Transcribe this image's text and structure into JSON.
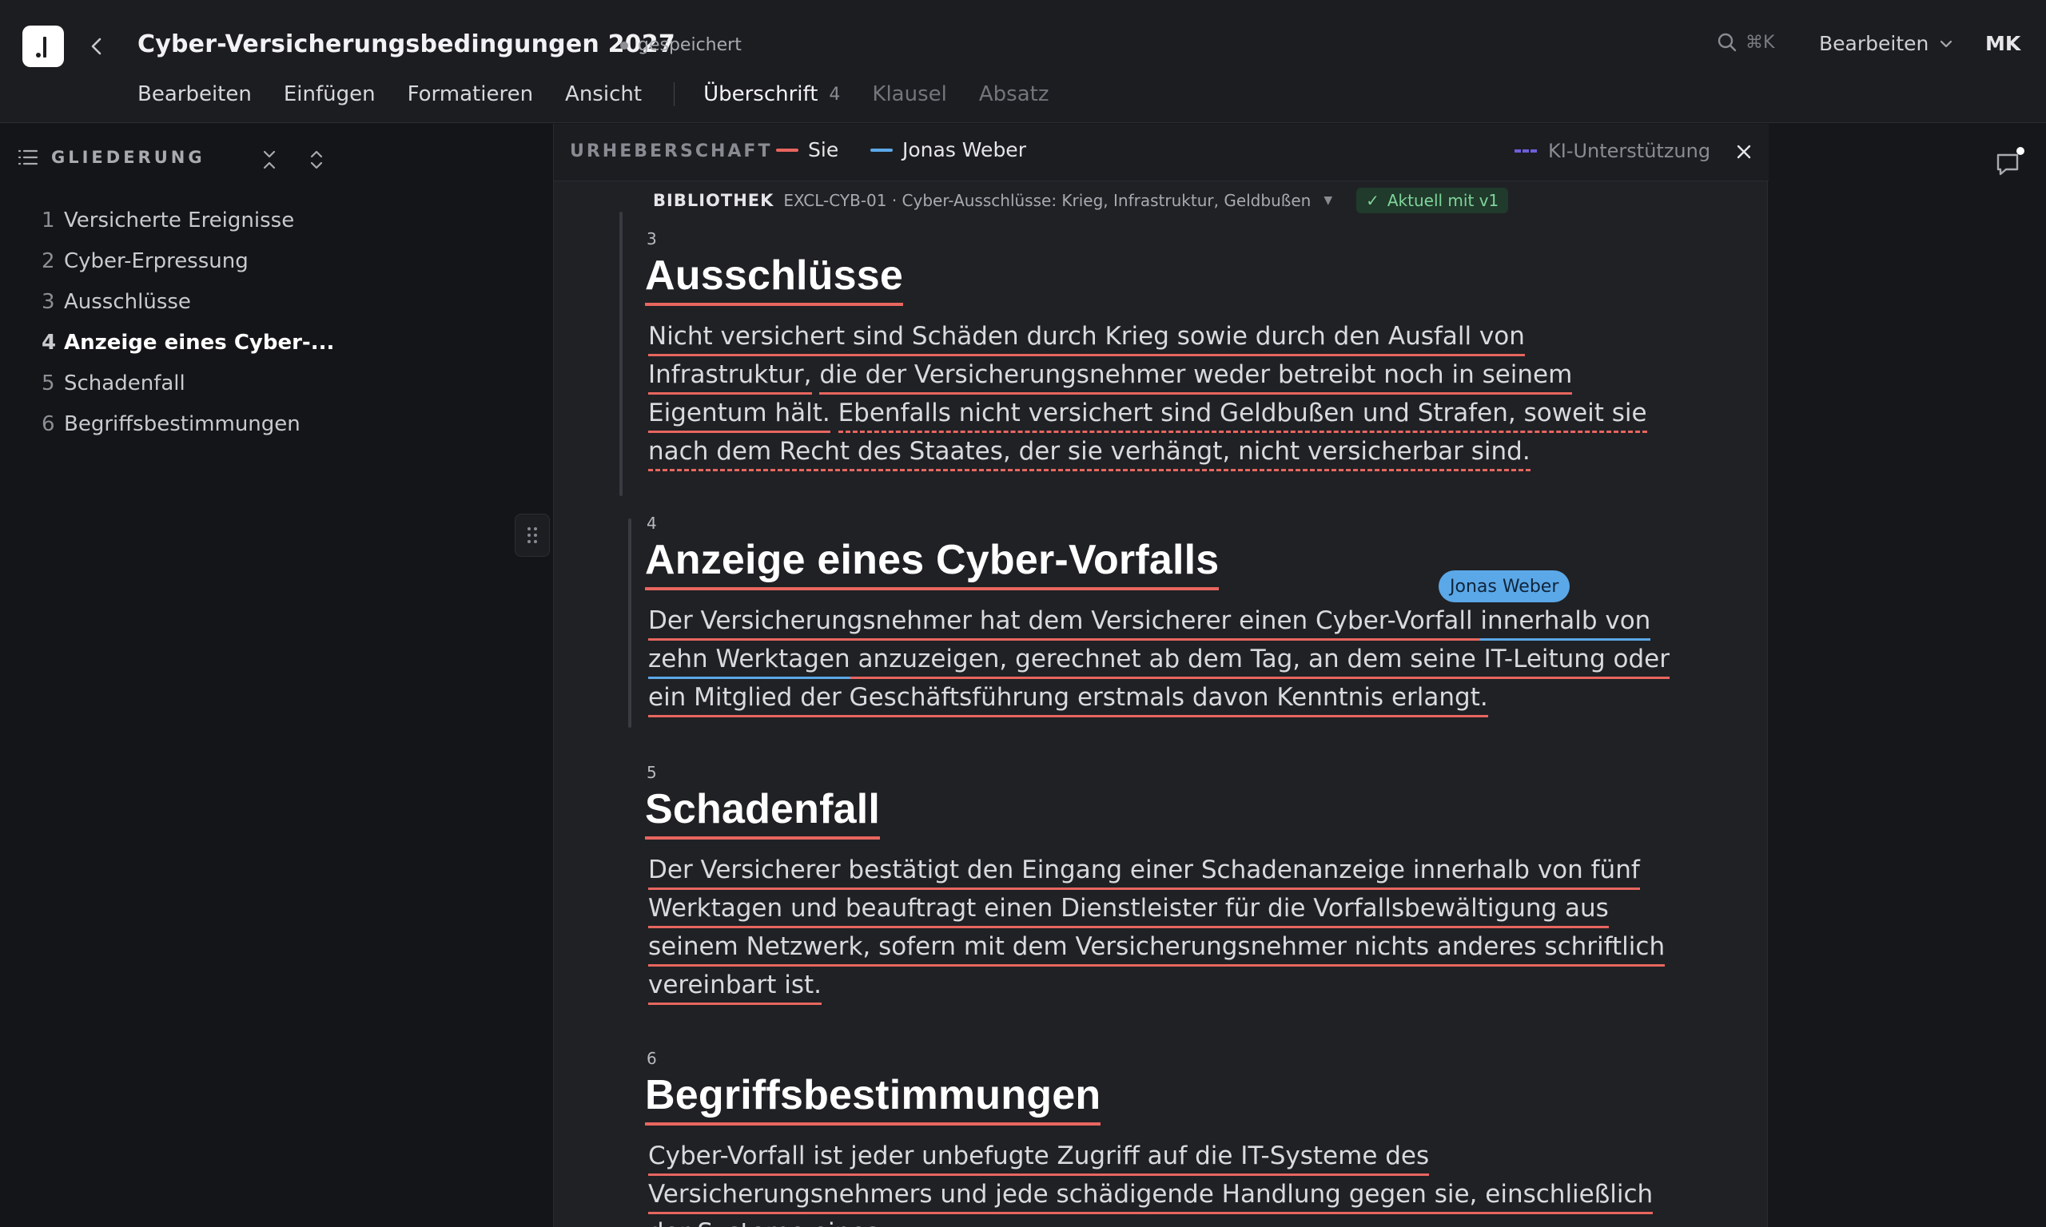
{
  "app": {
    "document_title": "Cyber-Versicherungsbedingungen 2027",
    "save_status": "gespeichert",
    "search_shortcut": "⌘K",
    "mode_label": "Bearbeiten",
    "user_initials": "MK"
  },
  "menu": {
    "items": [
      "Bearbeiten",
      "Einfügen",
      "Formatieren",
      "Ansicht"
    ],
    "styles": {
      "active": "Überschrift",
      "active_level": "4",
      "options": [
        "Klausel",
        "Absatz"
      ]
    }
  },
  "sidebar": {
    "title": "GLIEDERUNG",
    "items": [
      {
        "num": "1",
        "label": "Versicherte Ereignisse"
      },
      {
        "num": "2",
        "label": "Cyber-Erpressung"
      },
      {
        "num": "3",
        "label": "Ausschlüsse"
      },
      {
        "num": "4",
        "label": "Anzeige eines Cyber-..."
      },
      {
        "num": "5",
        "label": "Schadenfall"
      },
      {
        "num": "6",
        "label": "Begriffsbestimmungen"
      }
    ],
    "active_index": 3
  },
  "authorship": {
    "label": "URHEBERSCHAFT",
    "authors": [
      {
        "name": "Sie",
        "color": "#e8665f"
      },
      {
        "name": "Jonas Weber",
        "color": "#5ba8e8"
      }
    ],
    "ai_label": "KI-Unterstützung",
    "ai_color": "#6c5fd8"
  },
  "library": {
    "tag": "BIBLIOTHEK",
    "reference": "EXCL-CYB-01 · Cyber-Ausschlüsse: Krieg, Infrastruktur, Geldbußen",
    "status": "Aktuell mit v1"
  },
  "clauses": [
    {
      "num": "3",
      "heading": "Ausschlüsse",
      "lines": [
        "Nicht versichert sind Schäden durch Krieg sowie durch den Ausfall von Infrastruktur,",
        "die der Versicherungsnehmer weder betreibt noch in seinem Eigentum hält.",
        "Ebenfalls nicht versichert sind Geldbußen und Strafen, soweit sie nach dem Recht des Staates, der sie verhängt, nicht versicherbar sind."
      ]
    },
    {
      "num": "4",
      "heading": "Anzeige eines Cyber-Vorfalls",
      "lines": [
        "Der Versicherungsnehmer hat dem Versicherer einen Cyber-Vorfall ",
        "innerhalb von zehn Werktagen",
        " anzuzeigen, gerechnet ab dem Tag, an dem seine IT-Leitung oder ein Mitglied der Geschäftsführung erstmals davon Kenntnis erlangt."
      ],
      "cursor_user": "Jonas Weber"
    },
    {
      "num": "5",
      "heading": "Schadenfall",
      "text": "Der Versicherer bestätigt den Eingang einer Schadenanzeige innerhalb von fünf Werktagen und beauftragt einen Dienstleister für die Vorfallsbewältigung aus seinem Netzwerk, sofern mit dem Versicherungsnehmer nichts anderes schriftlich vereinbart ist."
    },
    {
      "num": "6",
      "heading": "Begriffsbestimmungen",
      "text": "Cyber-Vorfall ist jeder unbefugte Zugriff auf die IT-Systeme des Versicherungsnehmers und jede schädigende Handlung gegen sie, einschließlich der Systeme eines"
    }
  ]
}
